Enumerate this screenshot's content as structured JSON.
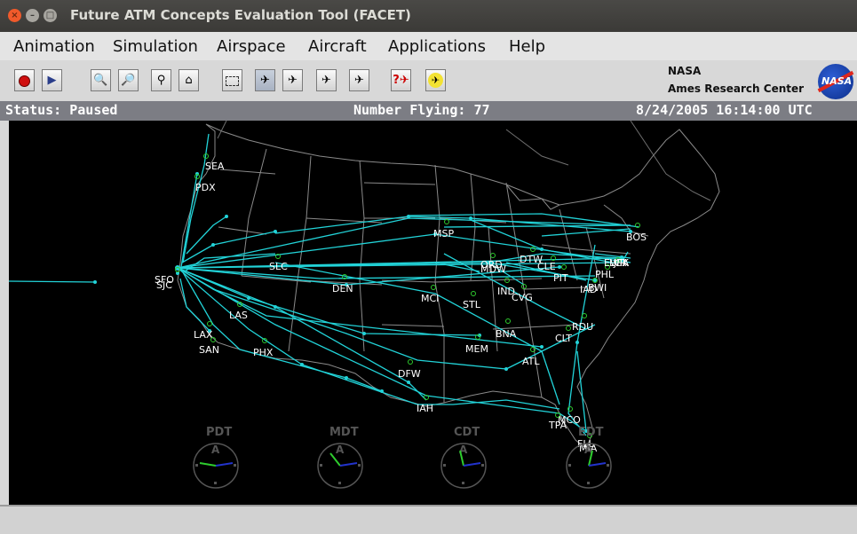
{
  "window": {
    "title": "Future ATM Concepts Evaluation Tool (FACET)"
  },
  "menu": [
    "Animation",
    "Simulation",
    "Airspace",
    "Aircraft",
    "Applications",
    "Help"
  ],
  "toolbar": {
    "buttons": [
      {
        "name": "stop-button",
        "icon": "record-icon"
      },
      {
        "name": "play-button",
        "icon": "play-icon"
      },
      {
        "name": "zoom-in-button",
        "icon": "zoom-in-icon"
      },
      {
        "name": "zoom-out-button",
        "icon": "zoom-out-icon"
      },
      {
        "name": "zoom-button",
        "icon": "magnifier-icon"
      },
      {
        "name": "home-button",
        "icon": "home-icon"
      },
      {
        "name": "select-region-button",
        "icon": "dashed-rectangle-icon"
      },
      {
        "name": "aircraft-label-button",
        "icon": "aircraft-label-icon"
      },
      {
        "name": "aircraft-track-button",
        "icon": "aircraft-track-icon"
      },
      {
        "name": "aircraft-departure-button",
        "icon": "aircraft-departure-icon"
      },
      {
        "name": "aircraft-arrival-button",
        "icon": "aircraft-arrival-icon"
      },
      {
        "name": "aircraft-query-button",
        "icon": "aircraft-query-icon"
      },
      {
        "name": "aircraft-highlight-button",
        "icon": "aircraft-highlight-icon"
      }
    ]
  },
  "branding": {
    "line1": "NASA",
    "line2": "Ames Research Center",
    "logo_text": "NASA"
  },
  "status": {
    "state": "Status: Paused",
    "flying": "Number Flying: 77",
    "datetime": "8/24/2005  16:14:00 UTC"
  },
  "airports": [
    {
      "code": "SEA"
    },
    {
      "code": "PDX"
    },
    {
      "code": "SFO"
    },
    {
      "code": "SJC"
    },
    {
      "code": "LAX"
    },
    {
      "code": "SAN"
    },
    {
      "code": "LAS"
    },
    {
      "code": "PHX"
    },
    {
      "code": "SLC"
    },
    {
      "code": "DEN"
    },
    {
      "code": "MSP"
    },
    {
      "code": "MCI"
    },
    {
      "code": "STL"
    },
    {
      "code": "DFW"
    },
    {
      "code": "IAH"
    },
    {
      "code": "MEM"
    },
    {
      "code": "BNA"
    },
    {
      "code": "ATL"
    },
    {
      "code": "CLT"
    },
    {
      "code": "RDU"
    },
    {
      "code": "CVG"
    },
    {
      "code": "IND"
    },
    {
      "code": "ORD"
    },
    {
      "code": "MDW"
    },
    {
      "code": "DTW"
    },
    {
      "code": "CLE"
    },
    {
      "code": "PIT"
    },
    {
      "code": "IAD"
    },
    {
      "code": "BWI"
    },
    {
      "code": "PHL"
    },
    {
      "code": "EWR"
    },
    {
      "code": "LGA"
    },
    {
      "code": "JFK"
    },
    {
      "code": "BOS"
    },
    {
      "code": "MCO"
    },
    {
      "code": "TPA"
    },
    {
      "code": "FLL"
    },
    {
      "code": "MIA"
    }
  ],
  "clocks": [
    {
      "zone": "PDT",
      "mode": "A"
    },
    {
      "zone": "MDT",
      "mode": "A"
    },
    {
      "zone": "CDT",
      "mode": "A"
    },
    {
      "zone": "EDT",
      "mode": "A"
    }
  ],
  "colors": {
    "flight_track": "#22d3d8",
    "airport": "#2ecc2e",
    "map_lines": "#8a8a8a",
    "background": "#000000"
  }
}
